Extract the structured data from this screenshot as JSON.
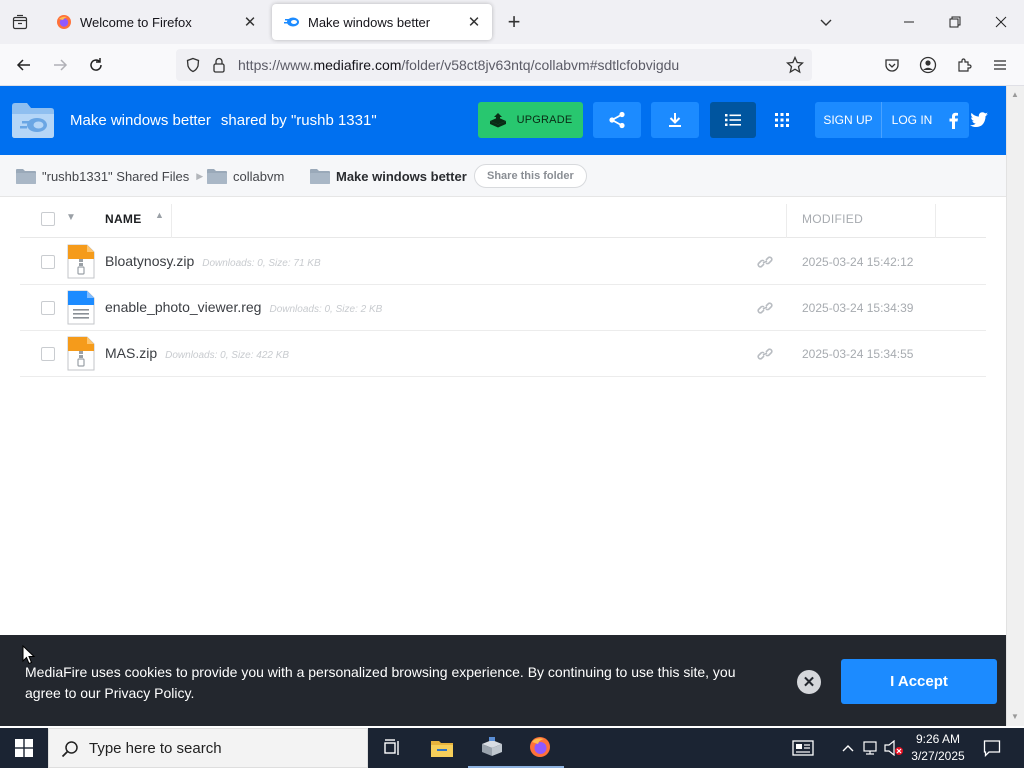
{
  "browser": {
    "tabs": [
      {
        "label": "Welcome to Firefox",
        "active": false
      },
      {
        "label": "Make windows better",
        "active": true
      }
    ],
    "close_glyph": "✕",
    "new_tab_glyph": "+",
    "url_prefix": "https://www.",
    "url_domain": "mediafire.com",
    "url_path": "/folder/v58ct8jv63ntq/collabvm#sdtlcfobvigdu"
  },
  "header": {
    "folder_name": "Make windows better",
    "shared_by": "shared by \"rushb 1331\"",
    "upgrade_label": "UPGRADE",
    "signup_label": "SIGN UP",
    "login_label": "LOG IN",
    "brand_color": "#0070f0"
  },
  "breadcrumb": {
    "items": [
      {
        "label": "\"rushb1331\" Shared Files"
      },
      {
        "label": "collabvm"
      },
      {
        "label": "Make windows better"
      }
    ],
    "share_label": "Share this folder"
  },
  "file_list": {
    "col_name": "NAME",
    "col_modified": "MODIFIED",
    "files": [
      {
        "name": "Bloatynosy.zip",
        "meta": "Downloads: 0, Size: 71 KB",
        "modified": "2025-03-24 15:42:12",
        "icon": "zip-file-icon"
      },
      {
        "name": "enable_photo_viewer.reg",
        "meta": "Downloads: 0, Size: 2 KB",
        "modified": "2025-03-24 15:34:39",
        "icon": "reg-file-icon"
      },
      {
        "name": "MAS.zip",
        "meta": "Downloads: 0, Size: 422 KB",
        "modified": "2025-03-24 15:34:55",
        "icon": "zip-file-icon"
      }
    ]
  },
  "cookie_banner": {
    "text": "MediaFire uses cookies to provide you with a personalized browsing experience. By continuing to use this site, you agree to our Privacy Policy.",
    "close_glyph": "✕",
    "accept_label": "I Accept"
  },
  "taskbar": {
    "search_placeholder": "Type here to search",
    "time": "9:26 AM",
    "date": "3/27/2025"
  }
}
